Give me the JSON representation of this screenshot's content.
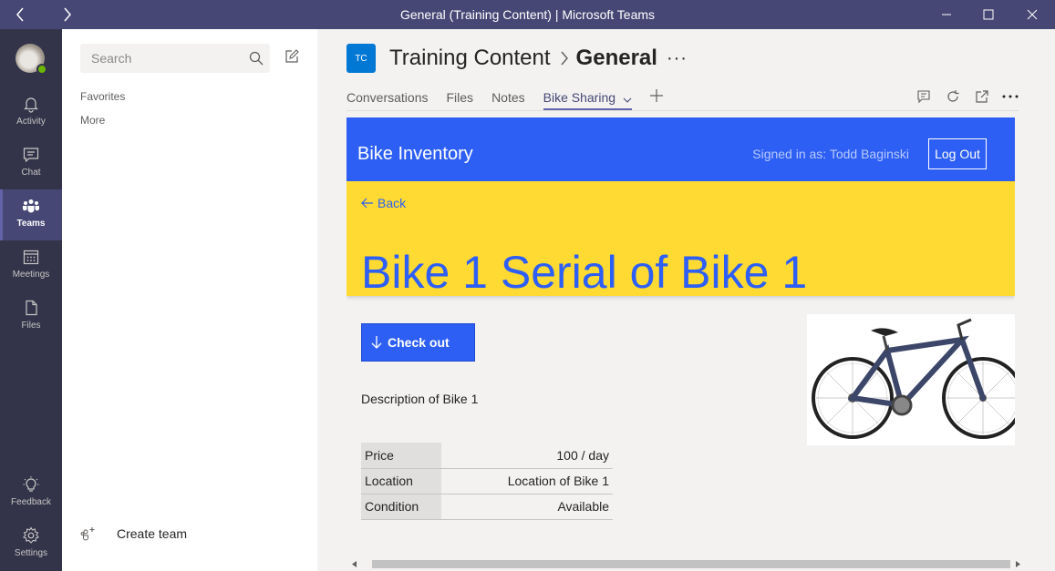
{
  "window": {
    "title": "General (Training Content) | Microsoft Teams"
  },
  "rail": {
    "items": [
      {
        "label": "Activity",
        "icon": "bell-icon"
      },
      {
        "label": "Chat",
        "icon": "chat-icon"
      },
      {
        "label": "Teams",
        "icon": "teams-icon",
        "active": true
      },
      {
        "label": "Meetings",
        "icon": "calendar-icon"
      },
      {
        "label": "Files",
        "icon": "file-icon"
      }
    ],
    "bottom": [
      {
        "label": "Feedback",
        "icon": "lightbulb-icon"
      },
      {
        "label": "Settings",
        "icon": "gear-icon"
      }
    ],
    "presence_color": "#6bb700"
  },
  "leftpane": {
    "search_placeholder": "Search",
    "favorites_label": "Favorites",
    "more_label": "More",
    "create_team_label": "Create team"
  },
  "channel": {
    "team_initials": "TC",
    "team_name": "Training Content",
    "channel_name": "General",
    "tabs": [
      "Conversations",
      "Files",
      "Notes",
      "Bike Sharing"
    ],
    "active_tab": "Bike Sharing"
  },
  "app": {
    "title": "Bike Inventory",
    "signed_in": "Signed in as: Todd Baginski",
    "logout_label": "Log Out",
    "back_label": "Back",
    "bike_title": "Bike 1 Serial of Bike 1",
    "checkout_label": "Check out",
    "description": "Description of Bike 1",
    "properties": [
      {
        "key": "Price",
        "value": "100 / day"
      },
      {
        "key": "Location",
        "value": "Location of Bike 1"
      },
      {
        "key": "Condition",
        "value": "Available"
      }
    ]
  },
  "colors": {
    "teams_purple": "#464775",
    "app_blue": "#2e5ff4",
    "hero_yellow": "#ffda33"
  }
}
